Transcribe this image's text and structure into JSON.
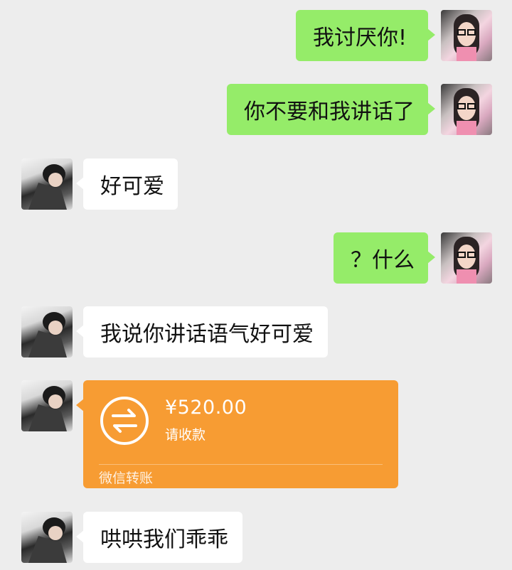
{
  "messages": [
    {
      "side": "right",
      "text": "我讨厌你!"
    },
    {
      "side": "right",
      "text": "你不要和我讲话了"
    },
    {
      "side": "left",
      "text": "好可爱"
    },
    {
      "side": "right",
      "text": "？什么"
    },
    {
      "side": "left",
      "text": "我说你讲话语气好可爱"
    },
    {
      "side": "left",
      "text": "哄哄我们乖乖"
    }
  ],
  "transfer": {
    "amount": "¥520.00",
    "status": "请收款",
    "footer": "微信转账",
    "icon": "transfer-arrows-icon",
    "color": "#f79c33"
  },
  "colors": {
    "background": "#ededed",
    "my_bubble": "#95ec69",
    "their_bubble": "#ffffff"
  }
}
